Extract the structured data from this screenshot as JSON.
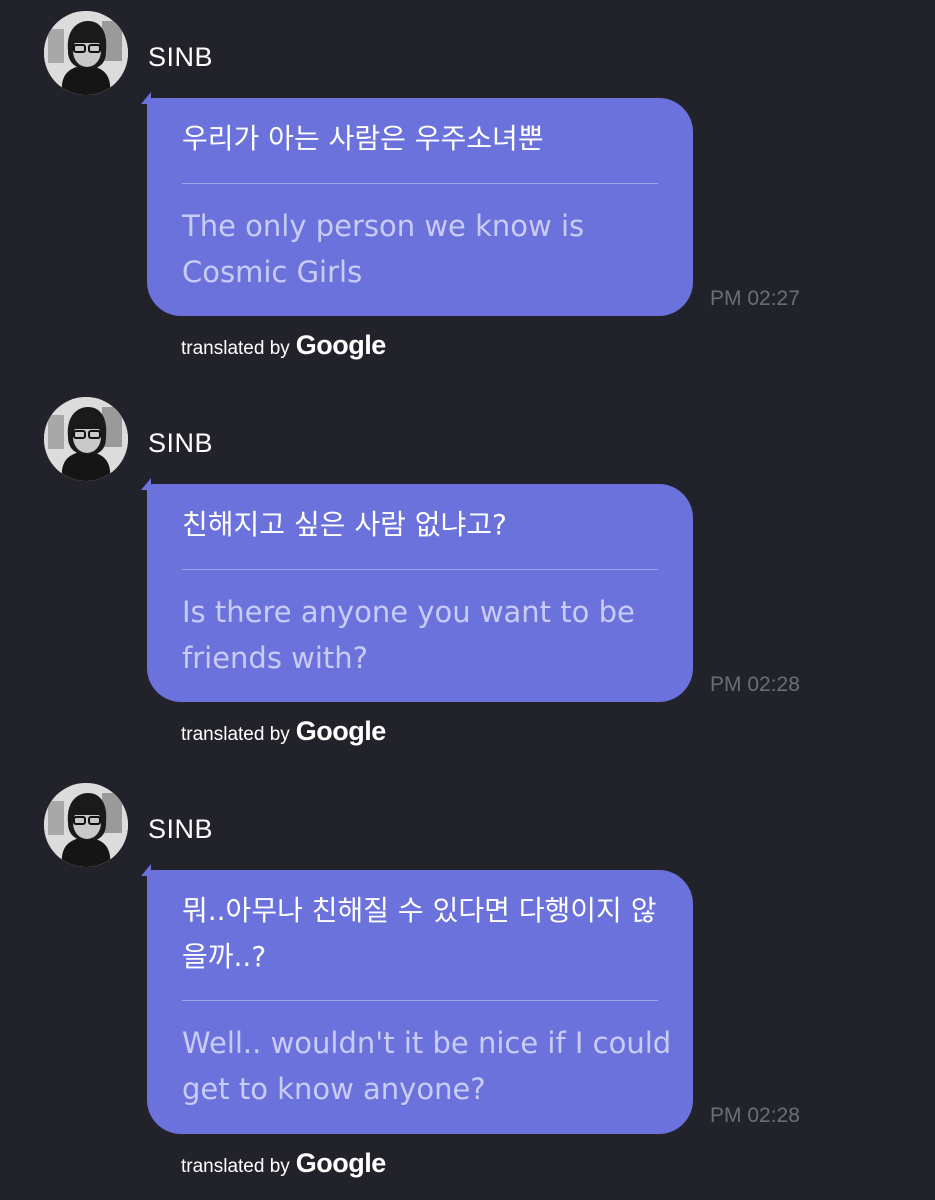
{
  "messages": [
    {
      "sender": "SINB",
      "avatar_icon": "profile-photo",
      "original": "우리가 아는 사람은 우주소녀뿐",
      "translation": "The only person we know is Cosmic Girls",
      "time": "PM 02:27",
      "translated_by": "translated by",
      "brand": "Google"
    },
    {
      "sender": "SINB",
      "avatar_icon": "profile-photo",
      "original": "친해지고 싶은 사람 없냐고?",
      "translation": "Is there anyone you want to be friends with?",
      "time": "PM 02:28",
      "translated_by": "translated by",
      "brand": "Google"
    },
    {
      "sender": "SINB",
      "avatar_icon": "profile-photo",
      "original": "뭐..아무나 친해질 수 있다면 다행이지 않을까..?",
      "translation": "Well.. wouldn't it be nice if I could get to know anyone?",
      "time": "PM 02:28",
      "translated_by": "translated by",
      "brand": "Google"
    }
  ],
  "colors": {
    "background": "#22222a",
    "bubble": "#6b72dc",
    "translation_text": "#c9ccf6",
    "timestamp": "#6d6e75"
  }
}
